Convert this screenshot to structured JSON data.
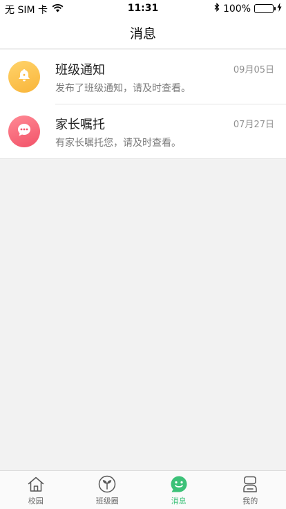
{
  "status_bar": {
    "carrier": "无 SIM 卡",
    "time": "11:31",
    "battery": "100%",
    "battery_level": 1.0
  },
  "nav": {
    "title": "消息"
  },
  "messages": [
    {
      "title": "班级通知",
      "date": "09月05日",
      "preview": "发布了班级通知，请及时查看。",
      "icon": "bell-icon",
      "color": "#f9b53a"
    },
    {
      "title": "家长嘱托",
      "date": "07月27日",
      "preview": "有家长嘱托您，请及时查看。",
      "icon": "chat-bubble-icon",
      "color": "#f25268"
    }
  ],
  "tabs": [
    {
      "label": "校园",
      "icon": "house-icon",
      "active": false
    },
    {
      "label": "班级圈",
      "icon": "sprout-icon",
      "active": false
    },
    {
      "label": "消息",
      "icon": "smiley-message-icon",
      "active": true
    },
    {
      "label": "我的",
      "icon": "profile-icon",
      "active": false
    }
  ],
  "colors": {
    "accent": "#3cc178",
    "background": "#f2f2f2"
  }
}
